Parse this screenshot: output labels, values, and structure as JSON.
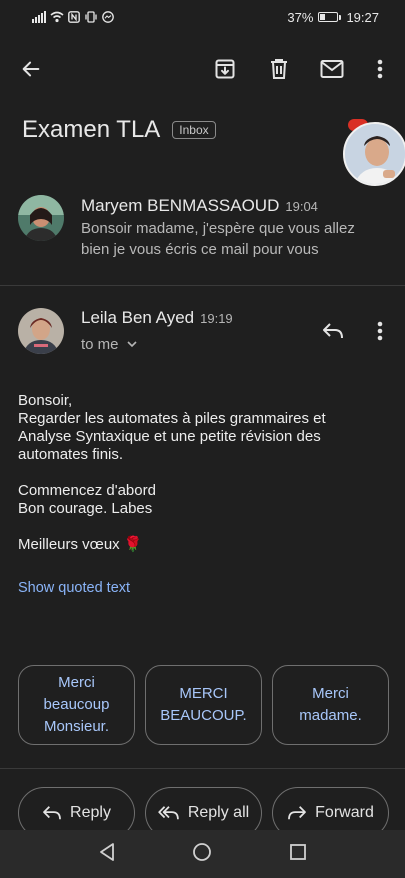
{
  "status": {
    "battery_pct": "37%",
    "battery_level": 0.37,
    "time": "19:27"
  },
  "toolbar": {
    "back": "arrow-back-icon",
    "archive": "archive-icon",
    "delete": "trash-icon",
    "mark_unread": "mail-icon",
    "more": "more-vert-icon"
  },
  "thread": {
    "subject": "Examen TLA",
    "label": "Inbox"
  },
  "messages": [
    {
      "sender": "Maryem BENMASSAOUD",
      "time": "19:04",
      "snippet": "Bonsoir madame, j'espère que vous allez bien je vous écris ce mail pour vous"
    },
    {
      "sender": "Leila Ben Ayed",
      "time": "19:19",
      "recipient": "to me",
      "body": {
        "greeting": "Bonsoir,",
        "line1": "Regarder les  automates à piles grammaires et",
        "line2": "Analyse Syntaxique et une petite révision  des",
        "line3": "automates finis.",
        "line4": "Commencez d'abord",
        "line5": "Bon courage. Labes",
        "closing": "Meilleurs vœux 🌹"
      },
      "show_quoted": "Show quoted text"
    }
  ],
  "smart_replies": [
    "Merci beaucoup Monsieur.",
    "MERCI BEAUCOUP.",
    "Merci madame."
  ],
  "actions": {
    "reply": "Reply",
    "reply_all": "Reply all",
    "forward": "Forward"
  },
  "colors": {
    "background": "#1f1f1f",
    "link": "#8ab4f8",
    "chip_text": "#a8c7fa",
    "badge": "#d93025"
  }
}
